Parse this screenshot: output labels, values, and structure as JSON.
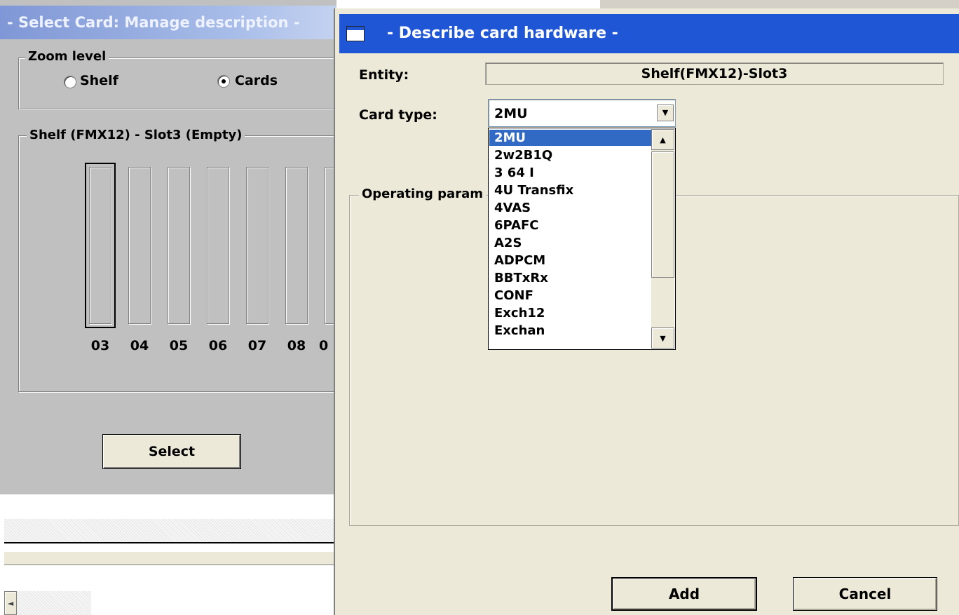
{
  "bg_window": {
    "title": "- Select Card: Manage description -",
    "zoom_group_title": "Zoom level",
    "zoom_options": [
      {
        "label": "Shelf",
        "checked": false
      },
      {
        "label": "Cards",
        "checked": true
      }
    ],
    "shelf_group_title": "Shelf (FMX12) - Slot3 (Empty)",
    "slot_labels": [
      "03",
      "04",
      "05",
      "06",
      "07",
      "08",
      "0"
    ],
    "selected_slot": "03",
    "select_button": "Select",
    "scroll_left_glyph": "◄"
  },
  "dialog": {
    "title": "- Describe card hardware -",
    "entity_label": "Entity:",
    "entity_value": "Shelf(FMX12)-Slot3",
    "card_type_label": "Card type:",
    "card_type_value": "2MU",
    "card_type_options": [
      "2MU",
      "2w2B1Q",
      "3 64 I",
      "4U Transfix",
      "4VAS",
      "6PAFC",
      "A2S",
      "ADPCM",
      "BBTxRx",
      "CONF",
      "Exch12",
      "Exchan"
    ],
    "card_type_highlighted": "2MU",
    "operating_group_title": "Operating param",
    "add_button": "Add",
    "cancel_button": "Cancel"
  }
}
